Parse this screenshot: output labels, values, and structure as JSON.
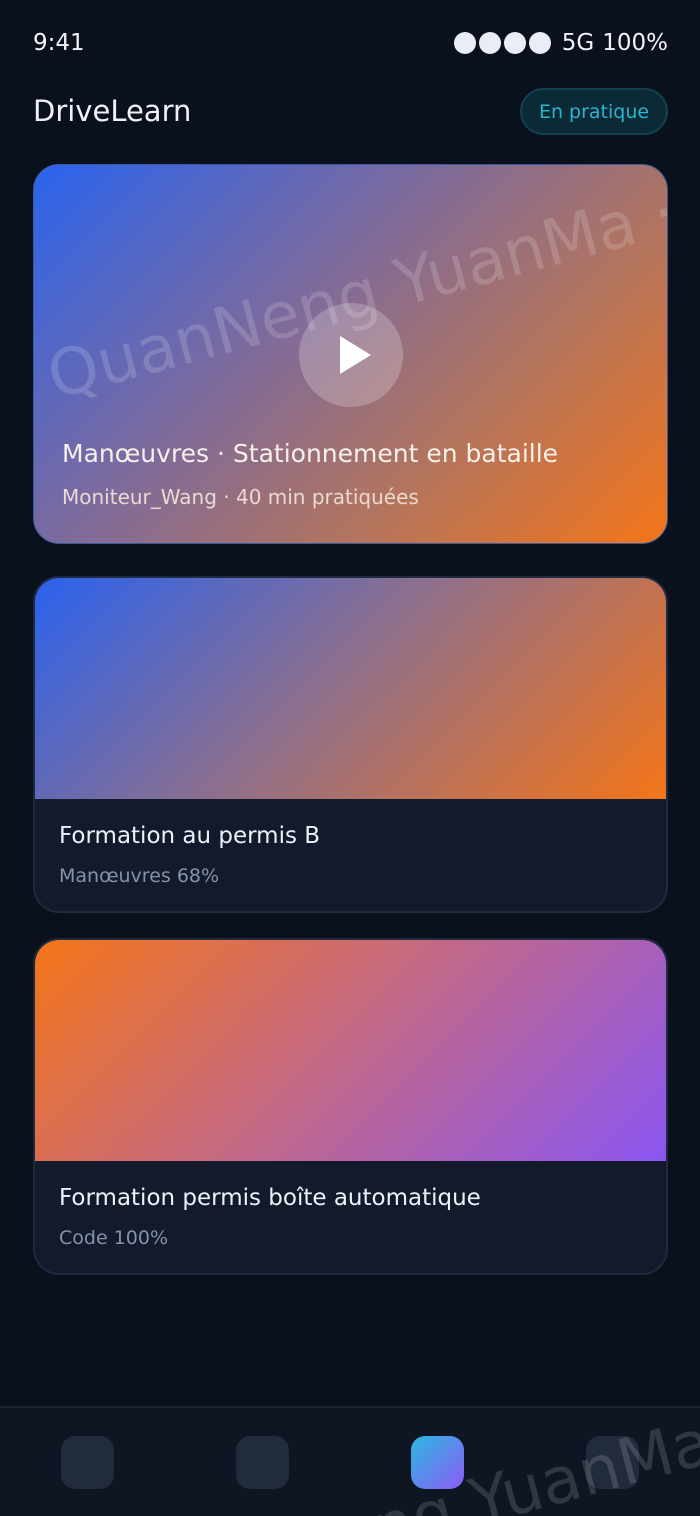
{
  "status_bar": {
    "time": "9:41",
    "network": "5G",
    "battery": "100%"
  },
  "header": {
    "app_title": "DriveLearn",
    "mode_badge": "En pratique"
  },
  "hero": {
    "watermark": "QuanNeng YuanMa · in",
    "title": "Manœuvres · Stationnement en bataille",
    "meta": "Moniteur_Wang · 40 min pratiquées"
  },
  "courses": [
    {
      "title": "Formation au permis B",
      "meta": "Manœuvres 68%"
    },
    {
      "title": "Formation permis boîte automatique",
      "meta": "Code 100%"
    }
  ],
  "bottom_nav": {
    "watermark": "Neng YuanMa",
    "active_index": 2
  },
  "colors": {
    "background": "#0a111d",
    "accent": "#2bb4cf",
    "card": "#121a2b",
    "gradient_blue": "#2a62ee",
    "gradient_orange": "#f47518",
    "gradient_purple": "#8b56f2"
  }
}
